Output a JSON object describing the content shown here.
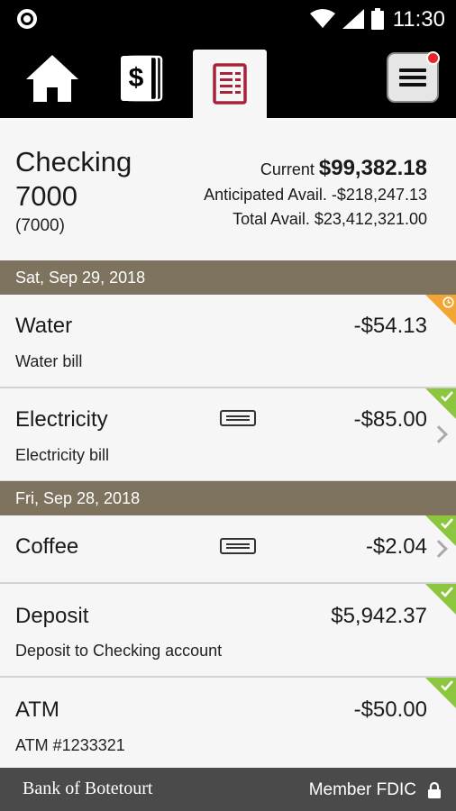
{
  "status_bar": {
    "time": "11:30"
  },
  "nav": {
    "tabs": [
      {
        "name": "home",
        "icon": "home-icon"
      },
      {
        "name": "accounts",
        "icon": "dollar-cards-icon"
      },
      {
        "name": "transactions",
        "icon": "ledger-icon",
        "selected": true
      },
      {
        "name": "menu",
        "icon": "menu-icon",
        "badge": true
      }
    ]
  },
  "account": {
    "name": "Checking 7000",
    "number": "(7000)",
    "current_label": "Current",
    "current_value": "$99,382.18",
    "anticipated_label": "Anticipated Avail.",
    "anticipated_value": "-$218,247.13",
    "total_label": "Total Avail.",
    "total_value": "$23,412,321.00"
  },
  "dates": [
    "Sat, Sep 29, 2018",
    "Fri, Sep 28, 2018"
  ],
  "transactions": [
    {
      "title": "Water",
      "description": "Water bill",
      "amount": "-$54.13",
      "status": "pending",
      "receipt": false,
      "chevron": false
    },
    {
      "title": "Electricity",
      "description": "Electricity bill",
      "amount": "-$85.00",
      "status": "cleared",
      "receipt": true,
      "chevron": true
    },
    {
      "title": "Coffee",
      "description": "",
      "amount": "-$2.04",
      "status": "cleared",
      "receipt": true,
      "chevron": true
    },
    {
      "title": "Deposit",
      "description": "Deposit to Checking account",
      "amount": "$5,942.37",
      "status": "cleared",
      "receipt": false,
      "chevron": false
    },
    {
      "title": "ATM",
      "description": "ATM #1233321",
      "amount": "-$50.00",
      "status": "cleared",
      "receipt": false,
      "chevron": false
    }
  ],
  "footer": {
    "bank": "Bank of Botetourt",
    "fdic": "Member FDIC"
  },
  "colors": {
    "date_bar": "#7d735e",
    "cleared": "#8cc63f",
    "pending": "#f3a534",
    "accent": "#a8223a",
    "badge": "#e8262c"
  }
}
